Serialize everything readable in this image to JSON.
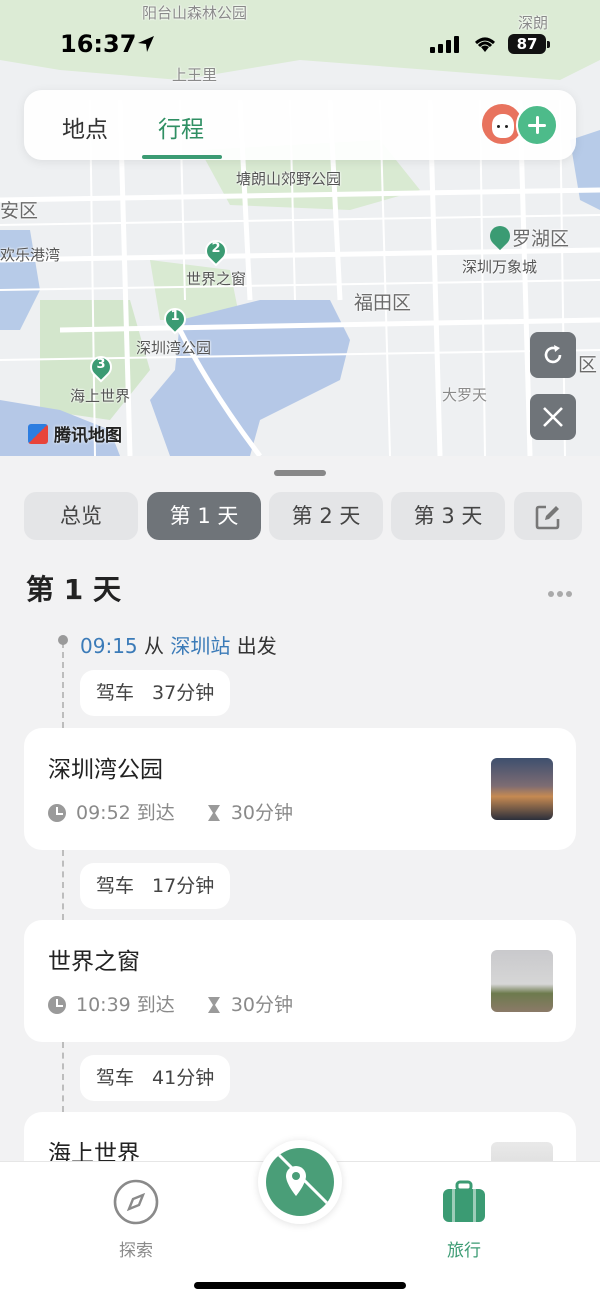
{
  "status_bar": {
    "time": "16:37",
    "battery": "87"
  },
  "map": {
    "labels": {
      "yangtai": "阳台山森林公园",
      "shangwangli": "上王里",
      "shenlang": "深朗",
      "tanglang": "塘朗山郊野公园",
      "anqu": "安区",
      "huanle": "欢乐港湾",
      "luohu": "罗湖区",
      "wanxiang": "深圳万象城",
      "futian": "福田区",
      "dalu": "大罗天",
      "qu": "区",
      "stop1": "深圳湾公园",
      "stop2": "世界之窗",
      "stop3": "海上世界"
    },
    "pins": {
      "p1": "1",
      "p2": "2",
      "p3": "3"
    },
    "brand": "腾讯地图"
  },
  "top_tabs": {
    "places": "地点",
    "itinerary": "行程"
  },
  "day_tabs": {
    "overview": "总览",
    "day1": "第 1 天",
    "day2": "第 2 天",
    "day3": "第 3 天"
  },
  "itinerary": {
    "day_title": "第 1 天",
    "departure": {
      "time": "09:15",
      "from": "从",
      "station": "深圳站",
      "action": "出发"
    },
    "drives": [
      {
        "mode": "驾车",
        "duration": "37分钟"
      },
      {
        "mode": "驾车",
        "duration": "17分钟"
      },
      {
        "mode": "驾车",
        "duration": "41分钟"
      }
    ],
    "stops": [
      {
        "name": "深圳湾公园",
        "arrive": "09:52 到达",
        "stay": "30分钟"
      },
      {
        "name": "世界之窗",
        "arrive": "10:39 到达",
        "stay": "30分钟"
      },
      {
        "name": "海上世界"
      }
    ]
  },
  "bottom_nav": {
    "explore": "探索",
    "travel": "旅行"
  },
  "colors": {
    "accent": "#3b9b73",
    "active_tab": "#6f7479",
    "link": "#3b7bb8"
  }
}
